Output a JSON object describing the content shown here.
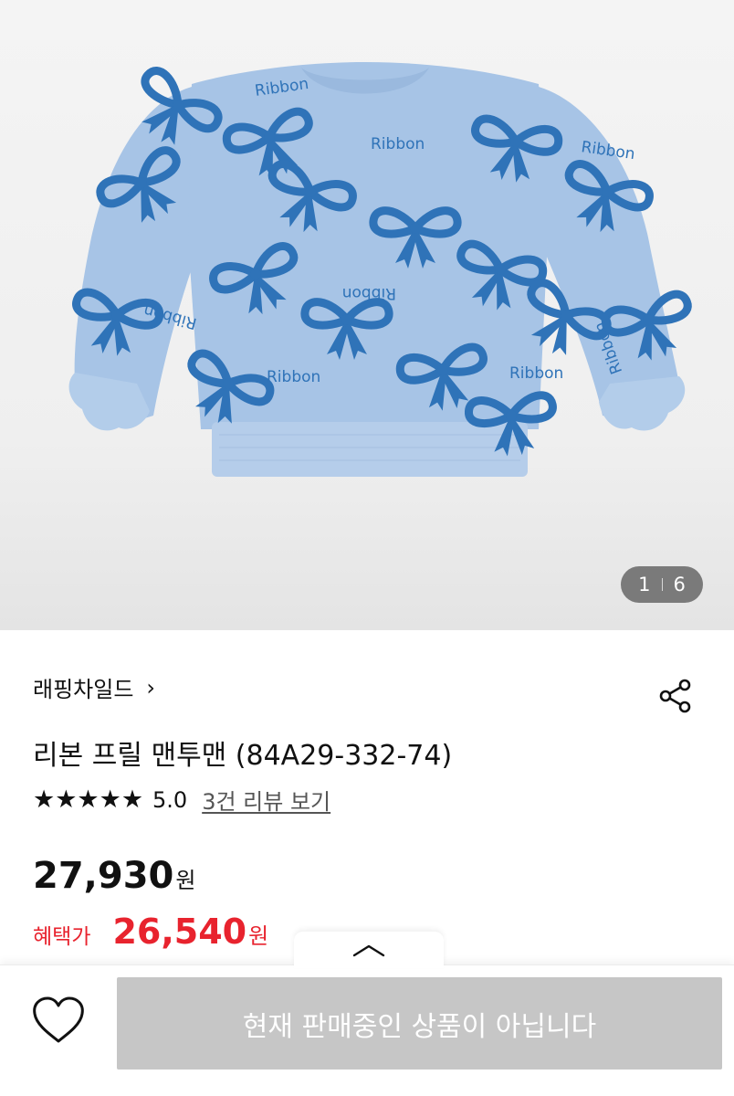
{
  "gallery": {
    "current_page": "1",
    "total_pages": "6",
    "print_text": "Ribbon"
  },
  "product": {
    "brand": "래핑차일드",
    "brand_chevron": "›",
    "title": "리본 프릴 맨투맨 (84A29-332-74)",
    "rating": {
      "stars": "★★★★★",
      "score": "5.0",
      "review_link": "3건 리뷰 보기"
    },
    "price": {
      "amount": "27,930",
      "unit": "원"
    },
    "benefit_price": {
      "label": "혜택가",
      "amount": "26,540",
      "unit": "원"
    }
  },
  "bottom_bar": {
    "cta_label": "현재 판매중인 상품이 아닙니다"
  },
  "icons": {
    "share": "share-icon",
    "heart": "heart-icon",
    "collapse": "chevron-up-icon"
  },
  "colors": {
    "accent_red": "#e8232e",
    "cta_disabled": "#c6c6c6",
    "sweater": "#a7c4e6",
    "bow": "#2f73b8"
  }
}
